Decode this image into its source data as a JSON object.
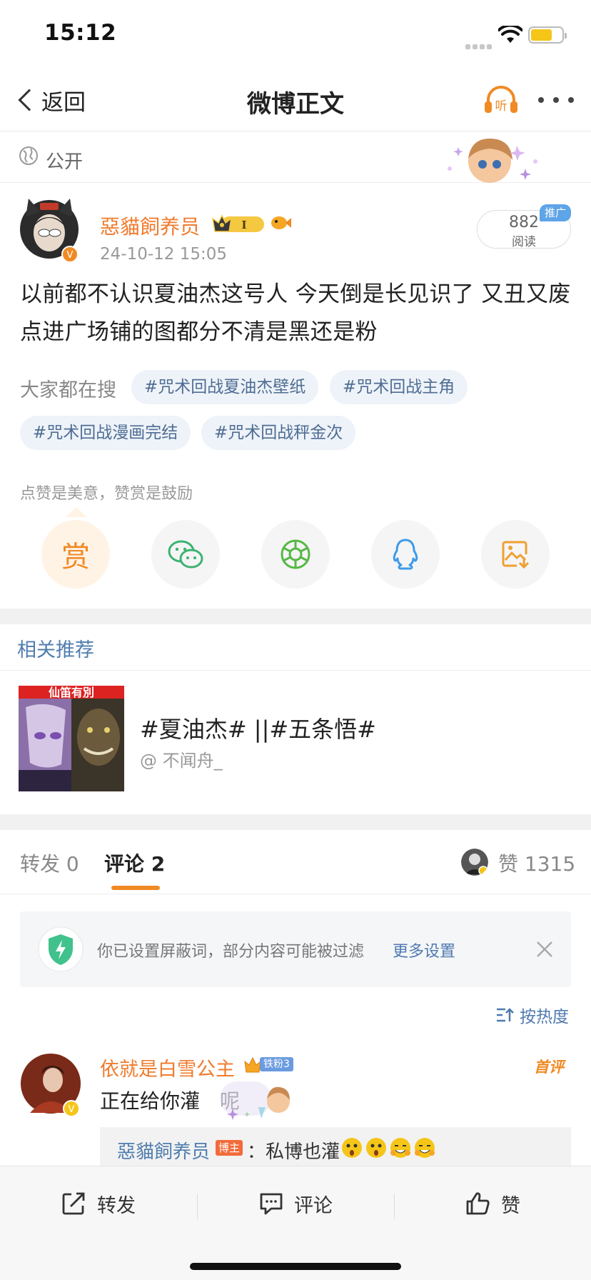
{
  "status": {
    "time": "15:12"
  },
  "nav": {
    "back_label": "返回",
    "title": "微博正文",
    "listen_label": "听"
  },
  "visibility": {
    "label": "公开"
  },
  "post": {
    "author": "惡貓飼养员",
    "time": "24-10-12 15:05",
    "vip_level": "I",
    "read_count": "882",
    "read_label": "阅读",
    "promo_tag": "推广",
    "text": "以前都不认识夏油杰这号人 今天倒是长见识了 又丑又废 点进广场铺的图都分不清是黑还是粉"
  },
  "trending": {
    "label": "大家都在搜",
    "chips": [
      "#咒术回战夏油杰壁纸",
      "#咒术回战主角",
      "#咒术回战漫画完结",
      "#咒术回战秤金次"
    ]
  },
  "reward": {
    "hint": "点赞是美意，赞赏是鼓励",
    "button": "赏"
  },
  "share_icons": [
    "reward-icon",
    "wechat-icon",
    "moments-icon",
    "qq-icon",
    "save-image-icon"
  ],
  "related": {
    "section_title": "相关推荐",
    "thumb_text": "仙笛有別",
    "title": "#夏油杰# ||#五条悟#",
    "author": "@ 不闻舟_"
  },
  "tabs": {
    "repost": "转发 0",
    "comment": "评论 2",
    "like": "赞 1315"
  },
  "filter_notice": {
    "text": "你已设置屏蔽词，部分内容可能被过滤",
    "link": "更多设置"
  },
  "sort": {
    "label": "按热度"
  },
  "comment": {
    "author": "依就是白雪公主",
    "fan_badge": "铁粉3",
    "first_tag": "首评",
    "text_before": "正在给你灌",
    "text_after": "呢",
    "reply": {
      "author": "惡貓飼养员",
      "host_tag": "博主",
      "text": "：私博也灌"
    }
  },
  "bottom": {
    "repost": "转发",
    "comment": "评论",
    "like": "赞"
  },
  "colors": {
    "accent_orange": "#f08a24",
    "link_blue": "#507dae",
    "chip_bg": "#eef3f9"
  }
}
